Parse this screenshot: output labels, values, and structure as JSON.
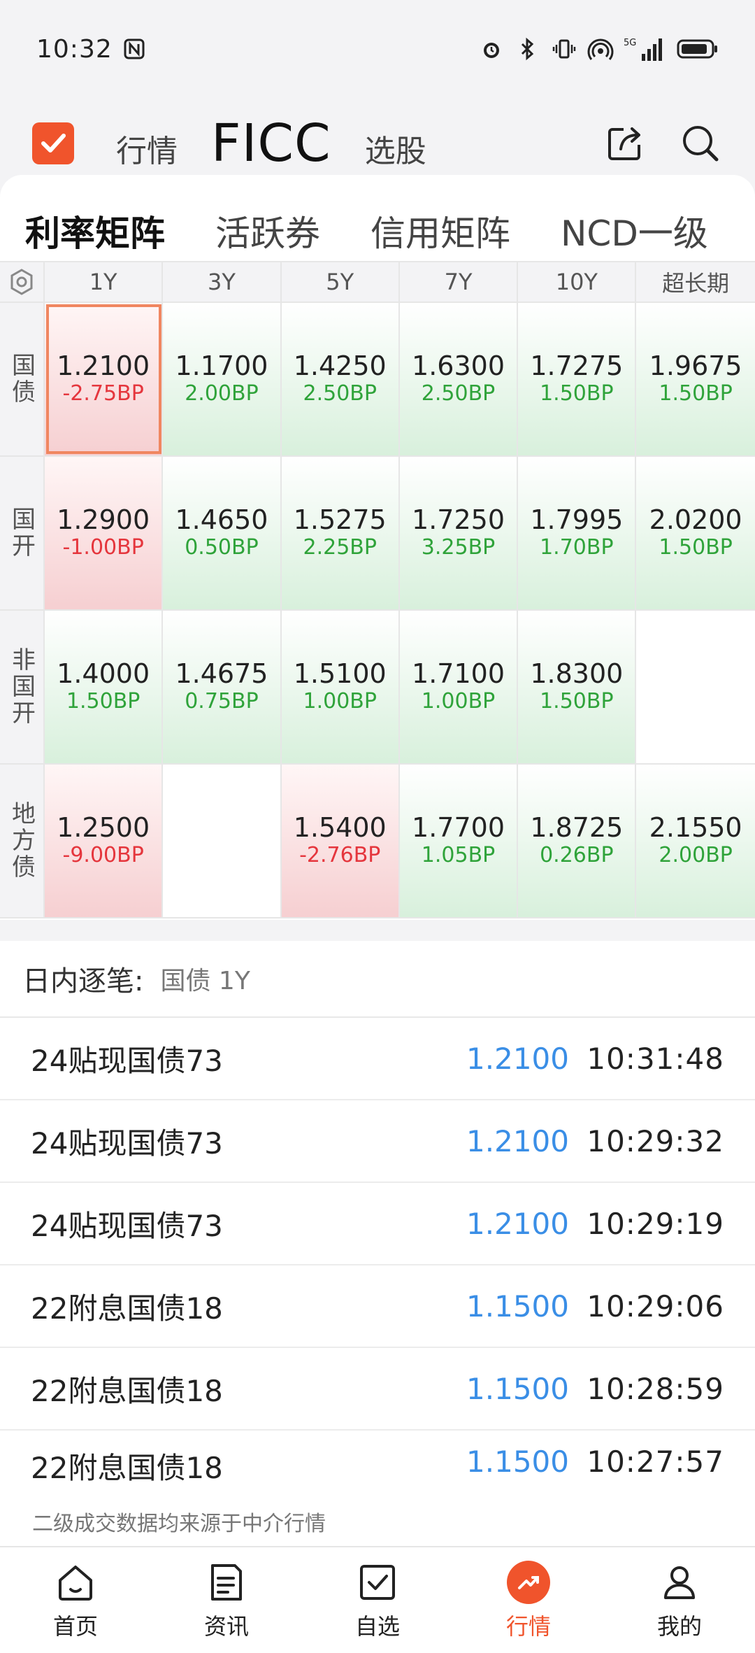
{
  "status_bar": {
    "time": "10:32",
    "nfc_icon": "nfc-icon",
    "signal_label": "5G"
  },
  "header": {
    "tabs": [
      "行情",
      "FICC",
      "选股"
    ],
    "active_tab": "FICC"
  },
  "sub_tabs": {
    "items": [
      "利率矩阵",
      "活跃券",
      "信用矩阵",
      "NCD一级"
    ],
    "active": "利率矩阵"
  },
  "matrix": {
    "columns": [
      "1Y",
      "3Y",
      "5Y",
      "7Y",
      "10Y",
      "超长期"
    ],
    "rows": [
      {
        "label": "国债",
        "cells": [
          {
            "value": "1.2100",
            "change": "-2.75BP",
            "dir": "down",
            "selected": true
          },
          {
            "value": "1.1700",
            "change": "2.00BP",
            "dir": "up"
          },
          {
            "value": "1.4250",
            "change": "2.50BP",
            "dir": "up"
          },
          {
            "value": "1.6300",
            "change": "2.50BP",
            "dir": "up"
          },
          {
            "value": "1.7275",
            "change": "1.50BP",
            "dir": "up"
          },
          {
            "value": "1.9675",
            "change": "1.50BP",
            "dir": "up"
          }
        ]
      },
      {
        "label": "国开",
        "cells": [
          {
            "value": "1.2900",
            "change": "-1.00BP",
            "dir": "down"
          },
          {
            "value": "1.4650",
            "change": "0.50BP",
            "dir": "up"
          },
          {
            "value": "1.5275",
            "change": "2.25BP",
            "dir": "up"
          },
          {
            "value": "1.7250",
            "change": "3.25BP",
            "dir": "up"
          },
          {
            "value": "1.7995",
            "change": "1.70BP",
            "dir": "up"
          },
          {
            "value": "2.0200",
            "change": "1.50BP",
            "dir": "up"
          }
        ]
      },
      {
        "label": "非国开",
        "cells": [
          {
            "value": "1.4000",
            "change": "1.50BP",
            "dir": "up"
          },
          {
            "value": "1.4675",
            "change": "0.75BP",
            "dir": "up"
          },
          {
            "value": "1.5100",
            "change": "1.00BP",
            "dir": "up"
          },
          {
            "value": "1.7100",
            "change": "1.00BP",
            "dir": "up"
          },
          {
            "value": "1.8300",
            "change": "1.50BP",
            "dir": "up"
          },
          {
            "value": "",
            "change": "",
            "dir": "empty"
          }
        ]
      },
      {
        "label": "地方债",
        "cells": [
          {
            "value": "1.2500",
            "change": "-9.00BP",
            "dir": "down"
          },
          {
            "value": "",
            "change": "",
            "dir": "empty"
          },
          {
            "value": "1.5400",
            "change": "-2.76BP",
            "dir": "down"
          },
          {
            "value": "1.7700",
            "change": "1.05BP",
            "dir": "up"
          },
          {
            "value": "1.8725",
            "change": "0.26BP",
            "dir": "up"
          },
          {
            "value": "2.1550",
            "change": "2.00BP",
            "dir": "up"
          }
        ]
      }
    ]
  },
  "ticks": {
    "title": "日内逐笔:",
    "selection": "国债 1Y",
    "rows": [
      {
        "name": "24贴现国债73",
        "yield": "1.2100",
        "time": "10:31:48"
      },
      {
        "name": "24贴现国债73",
        "yield": "1.2100",
        "time": "10:29:32"
      },
      {
        "name": "24贴现国债73",
        "yield": "1.2100",
        "time": "10:29:19"
      },
      {
        "name": "22附息国债18",
        "yield": "1.1500",
        "time": "10:29:06"
      },
      {
        "name": "22附息国债18",
        "yield": "1.1500",
        "time": "10:28:59"
      },
      {
        "name": "22附息国债18",
        "yield": "1.1500",
        "time": "10:27:57"
      }
    ],
    "note": "二级成交数据均来源于中介行情"
  },
  "bottom_nav": {
    "items": [
      {
        "label": "首页",
        "icon": "home-icon"
      },
      {
        "label": "资讯",
        "icon": "news-icon"
      },
      {
        "label": "自选",
        "icon": "watchlist-icon"
      },
      {
        "label": "行情",
        "icon": "market-icon"
      },
      {
        "label": "我的",
        "icon": "profile-icon"
      }
    ],
    "active": "行情"
  },
  "colors": {
    "accent": "#f0542c",
    "up": "#2fa33a",
    "down": "#e5363d",
    "yield_blue": "#3a8ee6"
  }
}
